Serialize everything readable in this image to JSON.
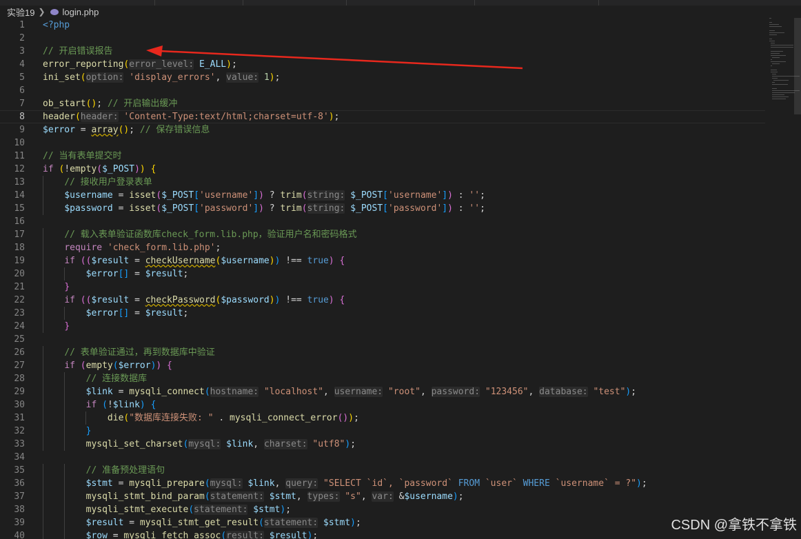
{
  "breadcrumb": {
    "folder": "实验19",
    "file": "login.php"
  },
  "lines": [
    {
      "n": "1",
      "html": "<span class=\"kw\">&lt;?php</span>"
    },
    {
      "n": "2",
      "html": ""
    },
    {
      "n": "3",
      "html": "<span class=\"cmt\">// 开启错误报告</span>"
    },
    {
      "n": "4",
      "html": "<span class=\"fn\">error_reporting</span><span class=\"b1\">(</span><span class=\"hint\">error_level:</span> <span class=\"var\">E_ALL</span><span class=\"b1\">)</span>;"
    },
    {
      "n": "5",
      "html": "<span class=\"fn\">ini_set</span><span class=\"b1\">(</span><span class=\"hint\">option:</span> <span class=\"str\">'display_errors'</span>, <span class=\"hint\">value:</span> <span class=\"num\">1</span><span class=\"b1\">)</span>;"
    },
    {
      "n": "6",
      "html": ""
    },
    {
      "n": "7",
      "html": "<span class=\"fn\">ob_start</span><span class=\"b1\">()</span>; <span class=\"cmt\">// 开启输出缓冲</span>"
    },
    {
      "n": "8",
      "html": "<span class=\"fn\">header</span><span class=\"b1\">(</span><span class=\"hint\">header:</span> <span class=\"str\">'Content-Type:text/html;charset=utf-8'</span><span class=\"b1\">)</span>;",
      "current": true
    },
    {
      "n": "9",
      "html": "<span class=\"var\">$error</span> = <span class=\"fn squig\">array</span><span class=\"b1\">()</span>; <span class=\"cmt\">// 保存错误信息</span>"
    },
    {
      "n": "10",
      "html": ""
    },
    {
      "n": "11",
      "html": "<span class=\"cmt\">// 当有表单提交时</span>"
    },
    {
      "n": "12",
      "html": "<span class=\"ctl\">if</span> <span class=\"b1\">(</span>!<span class=\"fn\">empty</span><span class=\"b2\">(</span><span class=\"var\">$_POST</span><span class=\"b2\">)</span><span class=\"b1\">)</span> <span class=\"b1\">{</span>"
    },
    {
      "n": "13",
      "html": "    <span class=\"cmt\">// 接收用户登录表单</span>"
    },
    {
      "n": "14",
      "html": "    <span class=\"var\">$username</span> = <span class=\"fn\">isset</span><span class=\"b2\">(</span><span class=\"var\">$_POST</span><span class=\"b3\">[</span><span class=\"str\">'username'</span><span class=\"b3\">]</span><span class=\"b2\">)</span> ? <span class=\"fn\">trim</span><span class=\"b2\">(</span><span class=\"hint\">string:</span> <span class=\"var\">$_POST</span><span class=\"b3\">[</span><span class=\"str\">'username'</span><span class=\"b3\">]</span><span class=\"b2\">)</span> : <span class=\"str\">''</span>;"
    },
    {
      "n": "15",
      "html": "    <span class=\"var\">$password</span> = <span class=\"fn\">isset</span><span class=\"b2\">(</span><span class=\"var\">$_POST</span><span class=\"b3\">[</span><span class=\"str\">'password'</span><span class=\"b3\">]</span><span class=\"b2\">)</span> ? <span class=\"fn\">trim</span><span class=\"b2\">(</span><span class=\"hint\">string:</span> <span class=\"var\">$_POST</span><span class=\"b3\">[</span><span class=\"str\">'password'</span><span class=\"b3\">]</span><span class=\"b2\">)</span> : <span class=\"str\">''</span>;"
    },
    {
      "n": "16",
      "html": ""
    },
    {
      "n": "17",
      "html": "    <span class=\"cmt\">// 载入表单验证函数库check_form.lib.php，验证用户名和密码格式</span>"
    },
    {
      "n": "18",
      "html": "    <span class=\"ctl\">require</span> <span class=\"str\">'check_form.lib.php'</span>;"
    },
    {
      "n": "19",
      "html": "    <span class=\"ctl\">if</span> <span class=\"b2\">((</span><span class=\"var\">$result</span> = <span class=\"fn squig\">checkUsername</span><span class=\"b1\">(</span><span class=\"var\">$username</span><span class=\"b1\">)</span><span class=\"b3\">)</span> !== <span class=\"kw\">true</span><span class=\"b2\">)</span> <span class=\"b2\">{</span>"
    },
    {
      "n": "20",
      "html": "        <span class=\"var\">$error</span><span class=\"b3\">[]</span> = <span class=\"var\">$result</span>;"
    },
    {
      "n": "21",
      "html": "    <span class=\"b2\">}</span>"
    },
    {
      "n": "22",
      "html": "    <span class=\"ctl\">if</span> <span class=\"b2\">((</span><span class=\"var\">$result</span> = <span class=\"fn squig\">checkPassword</span><span class=\"b1\">(</span><span class=\"var\">$password</span><span class=\"b1\">)</span><span class=\"b3\">)</span> !== <span class=\"kw\">true</span><span class=\"b2\">)</span> <span class=\"b2\">{</span>"
    },
    {
      "n": "23",
      "html": "        <span class=\"var\">$error</span><span class=\"b3\">[]</span> = <span class=\"var\">$result</span>;"
    },
    {
      "n": "24",
      "html": "    <span class=\"b2\">}</span>"
    },
    {
      "n": "25",
      "html": ""
    },
    {
      "n": "26",
      "html": "    <span class=\"cmt\">// 表单验证通过，再到数据库中验证</span>"
    },
    {
      "n": "27",
      "html": "    <span class=\"ctl\">if</span> <span class=\"b2\">(</span><span class=\"fn\">empty</span><span class=\"b3\">(</span><span class=\"var\">$error</span><span class=\"b3\">)</span><span class=\"b2\">)</span> <span class=\"b2\">{</span>"
    },
    {
      "n": "28",
      "html": "        <span class=\"cmt\">// 连接数据库</span>"
    },
    {
      "n": "29",
      "html": "        <span class=\"var\">$link</span> = <span class=\"fn\">mysqli_connect</span><span class=\"b3\">(</span><span class=\"hint\">hostname:</span> <span class=\"str\">\"localhost\"</span>, <span class=\"hint\">username:</span> <span class=\"str\">\"root\"</span>, <span class=\"hint\">password:</span> <span class=\"str\">\"123456\"</span>, <span class=\"hint\">database:</span> <span class=\"str\">\"test\"</span><span class=\"b3\">)</span>;"
    },
    {
      "n": "30",
      "html": "        <span class=\"ctl\">if</span> <span class=\"b3\">(</span>!<span class=\"var\">$link</span><span class=\"b3\">)</span> <span class=\"b3\">{</span>"
    },
    {
      "n": "31",
      "html": "            <span class=\"fn\">die</span><span class=\"b1\">(</span><span class=\"str\">\"数据库连接失败: \"</span> . <span class=\"fn\">mysqli_connect_error</span><span class=\"b2\">()</span><span class=\"b1\">)</span>;"
    },
    {
      "n": "32",
      "html": "        <span class=\"b3\">}</span>"
    },
    {
      "n": "33",
      "html": "        <span class=\"fn\">mysqli_set_charset</span><span class=\"b3\">(</span><span class=\"hint\">mysql:</span> <span class=\"var\">$link</span>, <span class=\"hint\">charset:</span> <span class=\"str\">\"utf8\"</span><span class=\"b3\">)</span>;"
    },
    {
      "n": "34",
      "html": ""
    },
    {
      "n": "35",
      "html": "        <span class=\"cmt\">// 准备预处理语句</span>"
    },
    {
      "n": "36",
      "html": "        <span class=\"var\">$stmt</span> = <span class=\"fn\">mysqli_prepare</span><span class=\"b3\">(</span><span class=\"hint\">mysql:</span> <span class=\"var\">$link</span>, <span class=\"hint\">query:</span> <span class=\"str\">\"SELECT `id`, `password` </span><span class=\"kw\">FROM</span><span class=\"str\"> `user` </span><span class=\"kw\">WHERE</span><span class=\"str\"> `username` = ?\"</span><span class=\"b3\">)</span>;"
    },
    {
      "n": "37",
      "html": "        <span class=\"fn\">mysqli_stmt_bind_param</span><span class=\"b3\">(</span><span class=\"hint\">statement:</span> <span class=\"var\">$stmt</span>, <span class=\"hint\">types:</span> <span class=\"str\">\"s\"</span>, <span class=\"hint\">var:</span> &amp;<span class=\"var\">$username</span><span class=\"b3\">)</span>;"
    },
    {
      "n": "38",
      "html": "        <span class=\"fn\">mysqli_stmt_execute</span><span class=\"b3\">(</span><span class=\"hint\">statement:</span> <span class=\"var\">$stmt</span><span class=\"b3\">)</span>;"
    },
    {
      "n": "39",
      "html": "        <span class=\"var\">$result</span> = <span class=\"fn\">mysqli_stmt_get_result</span><span class=\"b3\">(</span><span class=\"hint\">statement:</span> <span class=\"var\">$stmt</span><span class=\"b3\">)</span>;"
    },
    {
      "n": "40",
      "html": "        <span class=\"var\">$row</span> = <span class=\"fn\">mysqli_fetch_assoc</span><span class=\"b3\">(</span><span class=\"hint\">result:</span> <span class=\"var\">$result</span><span class=\"b3\">)</span>;"
    }
  ],
  "watermark": "CSDN @拿铁不拿铁",
  "colors": {
    "background": "#1e1e1e",
    "comment": "#6a9955",
    "string": "#ce9178",
    "function": "#dcdcaa",
    "variable": "#9cdcfe",
    "keyword": "#569cd6",
    "annotation_arrow": "#e8281d"
  }
}
